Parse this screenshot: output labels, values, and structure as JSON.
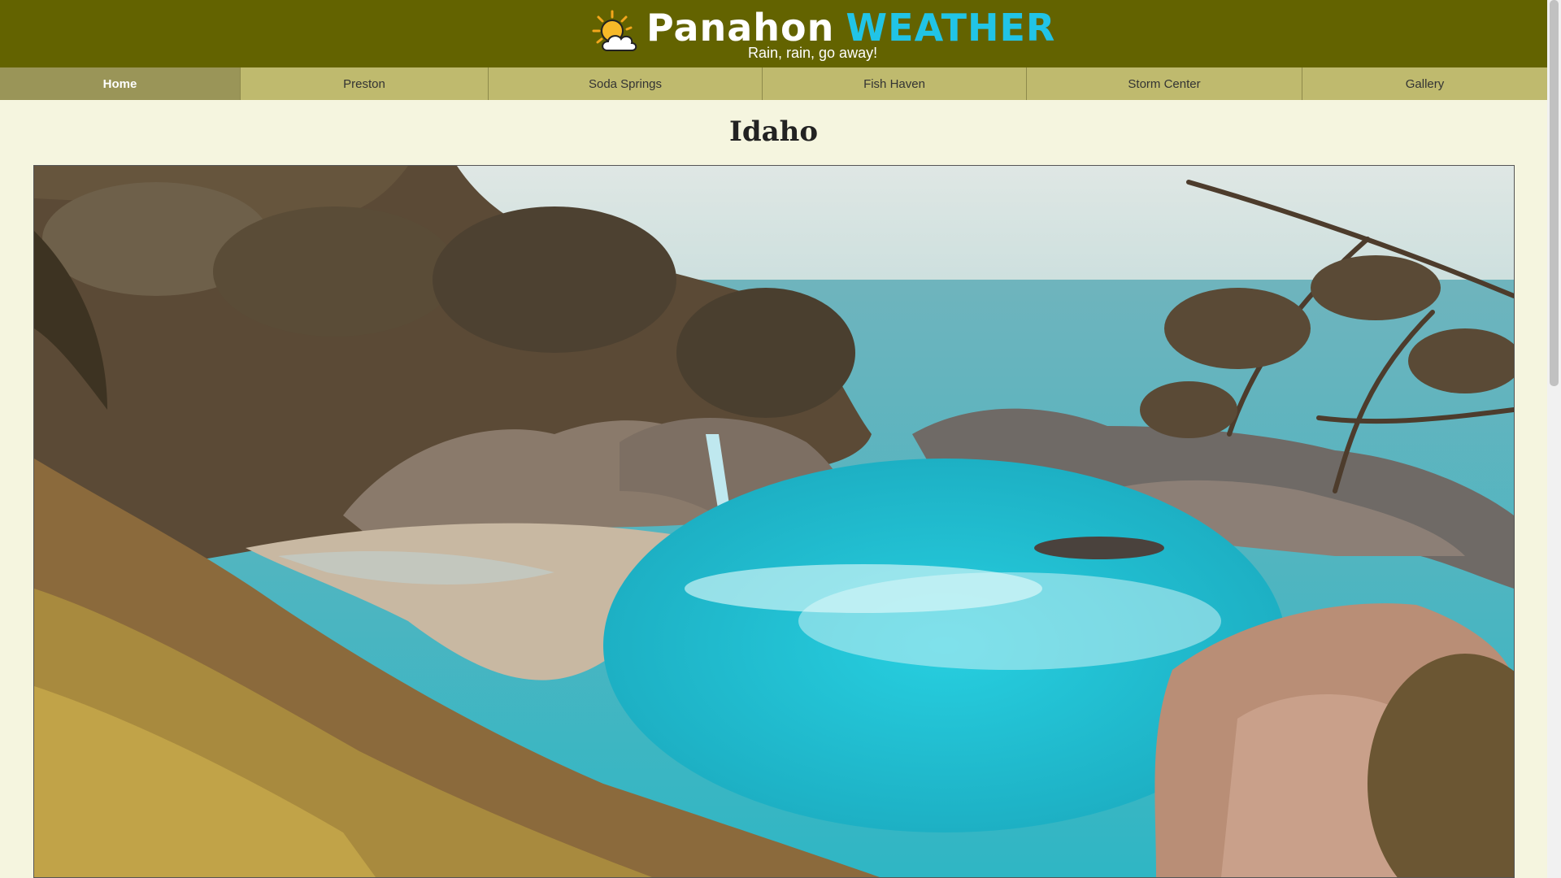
{
  "header": {
    "logo_icon": "sun-cloud-icon",
    "brand_part1": "Panahon",
    "brand_part2": "WEATHER",
    "tagline": "Rain, rain, go away!",
    "colors": {
      "header_bg": "#636300",
      "brand_accent": "#21c4e6"
    }
  },
  "nav": {
    "items": [
      {
        "label": "Home",
        "active": true
      },
      {
        "label": "Preston",
        "active": false
      },
      {
        "label": "Soda Springs",
        "active": false
      },
      {
        "label": "Fish Haven",
        "active": false
      },
      {
        "label": "Storm Center",
        "active": false
      },
      {
        "label": "Gallery",
        "active": false
      }
    ]
  },
  "main": {
    "title": "Idaho",
    "hero_image": "coastal-cove-waterfall-photo"
  }
}
